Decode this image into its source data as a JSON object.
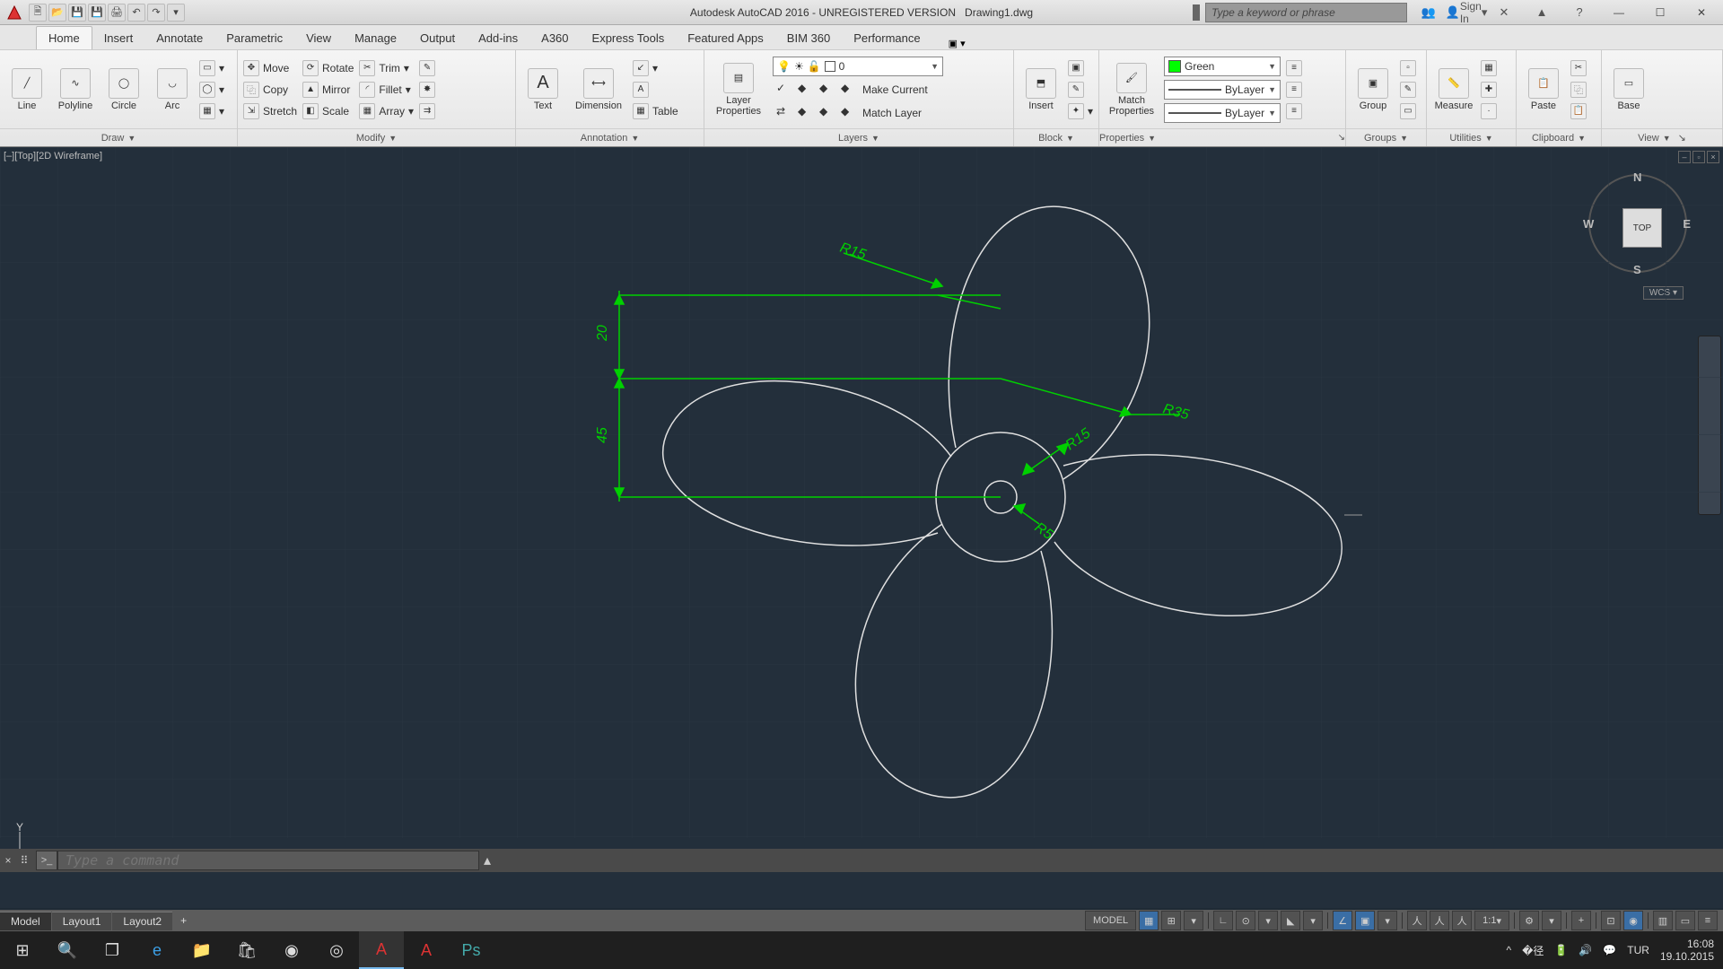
{
  "title": {
    "app": "Autodesk AutoCAD 2016 - UNREGISTERED VERSION",
    "doc": "Drawing1.dwg",
    "search_placeholder": "Type a keyword or phrase",
    "sign_in": "Sign In"
  },
  "tabs": {
    "items": [
      "Home",
      "Insert",
      "Annotate",
      "Parametric",
      "View",
      "Manage",
      "Output",
      "Add-ins",
      "A360",
      "Express Tools",
      "Featured Apps",
      "BIM 360",
      "Performance"
    ],
    "active": 0
  },
  "panels": {
    "draw": {
      "label": "Draw",
      "line": "Line",
      "polyline": "Polyline",
      "circle": "Circle",
      "arc": "Arc"
    },
    "modify": {
      "label": "Modify",
      "move": "Move",
      "copy": "Copy",
      "stretch": "Stretch",
      "rotate": "Rotate",
      "mirror": "Mirror",
      "scale": "Scale",
      "trim": "Trim",
      "fillet": "Fillet",
      "array": "Array"
    },
    "annotation": {
      "label": "Annotation",
      "text": "Text",
      "dimension": "Dimension",
      "table": "Table"
    },
    "layers": {
      "label": "Layers",
      "layer_properties": "Layer\nProperties",
      "make_current": "Make Current",
      "match_layer": "Match Layer",
      "current": "0"
    },
    "block": {
      "label": "Block",
      "insert": "Insert"
    },
    "properties": {
      "label": "Properties",
      "match": "Match\nProperties",
      "color": "Green",
      "linetype": "ByLayer",
      "lineweight": "ByLayer"
    },
    "groups": {
      "label": "Groups",
      "group": "Group"
    },
    "utilities": {
      "label": "Utilities",
      "measure": "Measure"
    },
    "clipboard": {
      "label": "Clipboard",
      "paste": "Paste"
    },
    "view": {
      "label": "View",
      "base": "Base"
    }
  },
  "viewport": {
    "controls": "[–][Top][2D Wireframe]",
    "cube": "TOP",
    "wcs": "WCS",
    "dirs": {
      "n": "N",
      "s": "S",
      "e": "E",
      "w": "W"
    },
    "ucs_y": "Y"
  },
  "dims": {
    "r15": "R15",
    "r35": "R35",
    "r15b": "R15",
    "r5": "R5",
    "v20": "20",
    "v45": "45"
  },
  "command": {
    "placeholder": "Type a command"
  },
  "layouts": {
    "model": "Model",
    "l1": "Layout1",
    "l2": "Layout2"
  },
  "status": {
    "model": "MODEL",
    "scale": "1:1"
  },
  "taskbar": {
    "lang": "TUR",
    "time": "16:08",
    "date": "19.10.2015"
  }
}
